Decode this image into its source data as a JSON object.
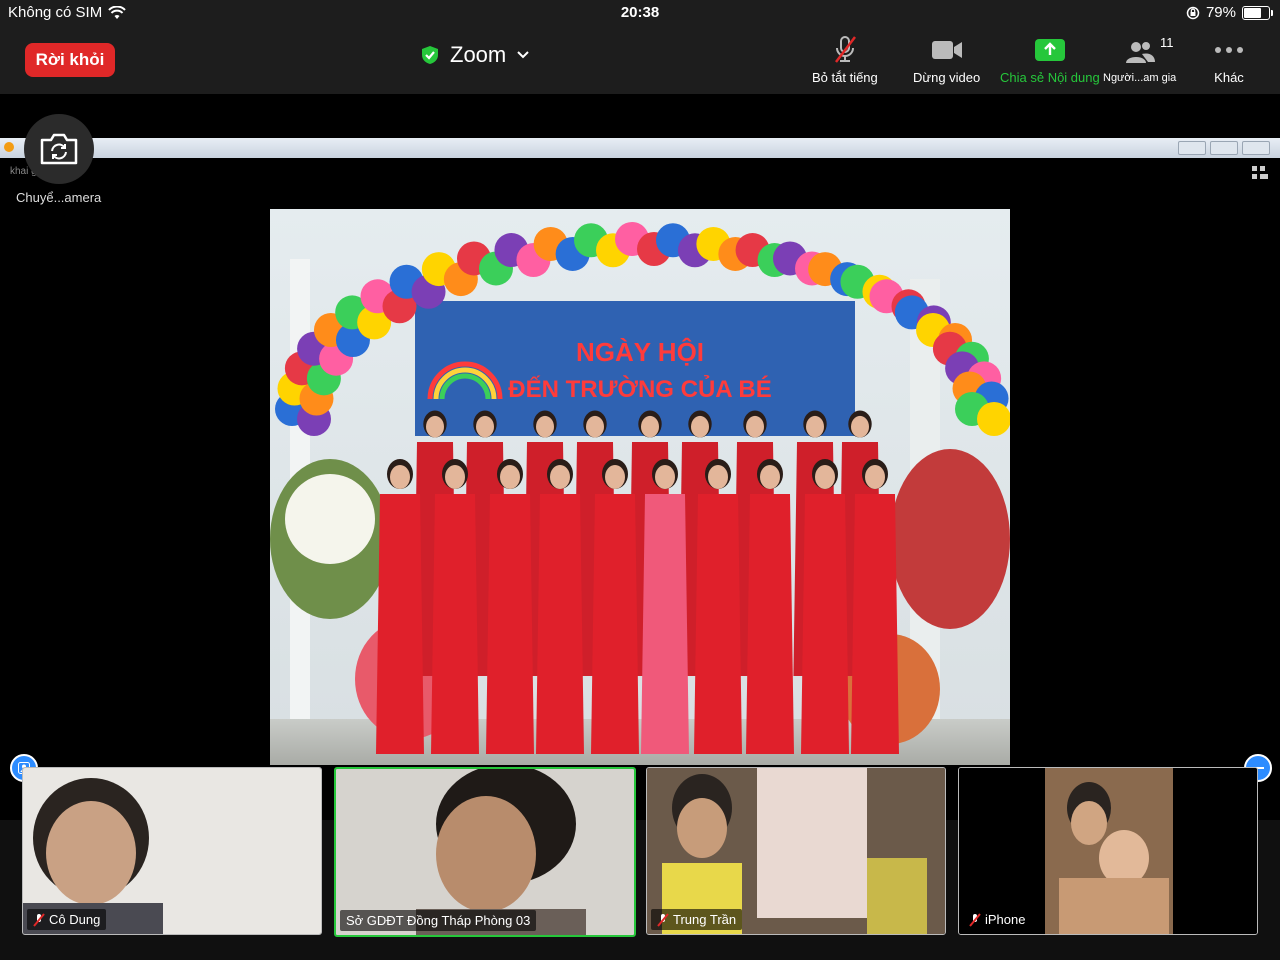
{
  "status_bar": {
    "carrier": "Không có SIM",
    "time": "20:38",
    "battery_percent": "79%",
    "battery_level": 0.79
  },
  "toolbar": {
    "leave_label": "Rời khỏi",
    "app_title": "Zoom",
    "mute_label": "Bỏ tắt tiếng",
    "stop_video_label": "Dừng video",
    "share_label": "Chia sẻ Nội dung",
    "participants_label": "Người...am gia",
    "participants_count": "11",
    "more_label": "Khác",
    "leave_color": "#e02828",
    "share_color": "#26c73b"
  },
  "shared_screen": {
    "window_label": "khai giảng",
    "camera_switch_label": "Chuyể...amera",
    "banner_title": "NGÀY HỘI",
    "banner_subtitle": "ĐẾN TRƯỜNG CỦA BÉ"
  },
  "participants": [
    {
      "name": "Cô Dung",
      "muted": true
    },
    {
      "name": "Sở GDĐT Đồng Tháp Phòng 03",
      "muted": false,
      "active": true
    },
    {
      "name": "Trung Trần",
      "muted": true
    },
    {
      "name": "iPhone",
      "muted": true
    }
  ]
}
